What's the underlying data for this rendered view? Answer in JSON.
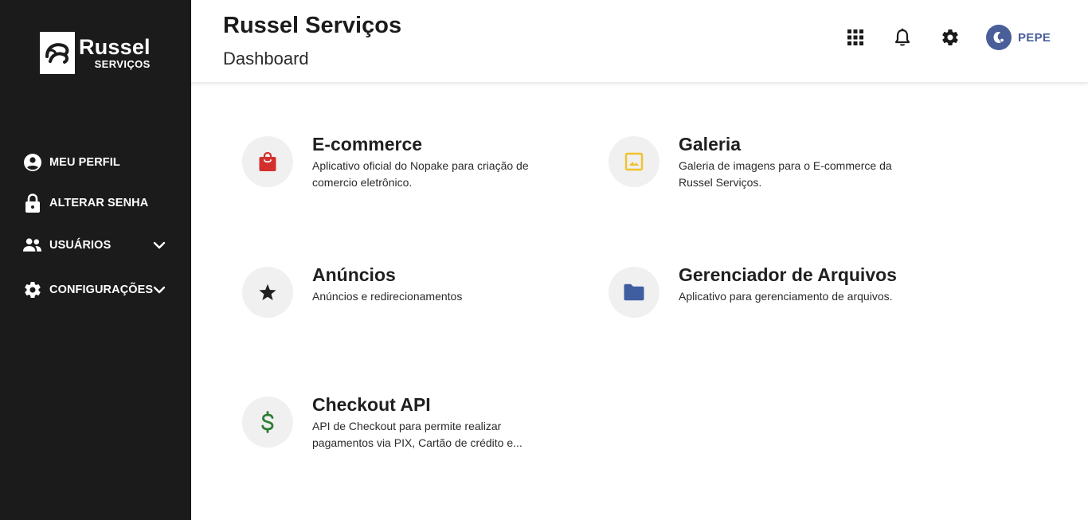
{
  "brand": {
    "name": "Russel",
    "sub": "SERVIÇOS"
  },
  "sidebar": {
    "items": [
      {
        "label": "MEU PERFIL",
        "icon": "account-circle-icon"
      },
      {
        "label": "ALTERAR SENHA",
        "icon": "lock-icon"
      },
      {
        "label": "USUÁRIOS",
        "icon": "people-icon",
        "expandable": true
      },
      {
        "label": "CONFIGURAÇÕES",
        "icon": "gear-icon",
        "expandable": true
      }
    ]
  },
  "header": {
    "title": "Russel Serviços",
    "subtitle": "Dashboard",
    "icons": [
      "apps-grid-icon",
      "bell-icon",
      "gear-icon"
    ],
    "user": {
      "name": "PEPE"
    }
  },
  "apps": [
    {
      "name": "E-commerce",
      "description": "Aplicativo oficial do Nopake para criação de comercio eletrônico.",
      "icon": "shopping-bag-icon",
      "color": "#d32f2f"
    },
    {
      "name": "Galeria",
      "description": "Galeria de imagens para o E-commerce da Russel Serviços.",
      "icon": "image-icon",
      "color": "#f2c12e"
    },
    {
      "name": "Anúncios",
      "description": "Anúncios e redirecionamentos",
      "icon": "star-icon",
      "color": "#1f1f1f"
    },
    {
      "name": "Gerenciador de Arquivos",
      "description": "Aplicativo para gerenciamento de arquivos.",
      "icon": "folder-icon",
      "color": "#3f5ea0"
    },
    {
      "name": "Checkout API",
      "description": "API de Checkout para permite realizar pagamentos via PIX, Cartão de crédito e...",
      "icon": "dollar-icon",
      "color": "#2e7d32"
    }
  ],
  "colors": {
    "sidebar_bg": "#1b1b1b",
    "accent": "#4a5e9a"
  }
}
